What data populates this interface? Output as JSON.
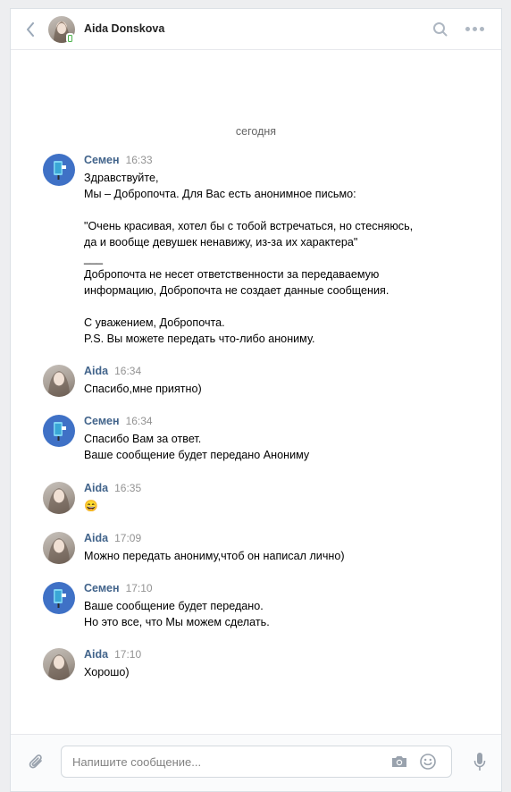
{
  "header": {
    "contact_name": "Aida Donskova",
    "back_icon": "chevron-left-icon",
    "search_icon": "search-icon",
    "more_icon": "more-dots-icon"
  },
  "date_divider": "сегодня",
  "messages": [
    {
      "author": "Семен",
      "time": "16:33",
      "lines": [
        "Здравствуйте,",
        "Мы – Добропочта. Для Вас есть анонимное письмо:",
        "",
        "\"Очень красивая, хотел бы с тобой встречаться, но стесняюсь,",
        "да и вообще девушек ненавижу, из-за их характера\"",
        "___",
        "Добропочта не несет ответственности за передаваемую",
        "информацию, Добропочта не создает данные сообщения.",
        "",
        "С уважением, Добропочта.",
        "P.S. Вы можете передать что-либо анониму."
      ]
    },
    {
      "author": "Aida",
      "time": "16:34",
      "lines": [
        "Спасибо,мне приятно)"
      ]
    },
    {
      "author": "Семен",
      "time": "16:34",
      "lines": [
        "Спасибо Вам за ответ.",
        "Ваше сообщение будет передано Анониму"
      ]
    },
    {
      "author": "Aida",
      "time": "16:35",
      "lines": [
        "😄"
      ]
    },
    {
      "author": "Aida",
      "time": "17:09",
      "lines": [
        "Можно передать анониму,чтоб он написал лично)"
      ]
    },
    {
      "author": "Семен",
      "time": "17:10",
      "lines": [
        "Ваше сообщение будет передано.",
        "Но это все, что Мы можем сделать."
      ]
    },
    {
      "author": "Aida",
      "time": "17:10",
      "lines": [
        "Хорошо)"
      ]
    }
  ],
  "composer": {
    "placeholder": "Напишите сообщение...",
    "value": ""
  },
  "colors": {
    "accent": "#42648b",
    "online_mobile": "#4bb34b",
    "bot_avatar": "#3f71c6"
  }
}
